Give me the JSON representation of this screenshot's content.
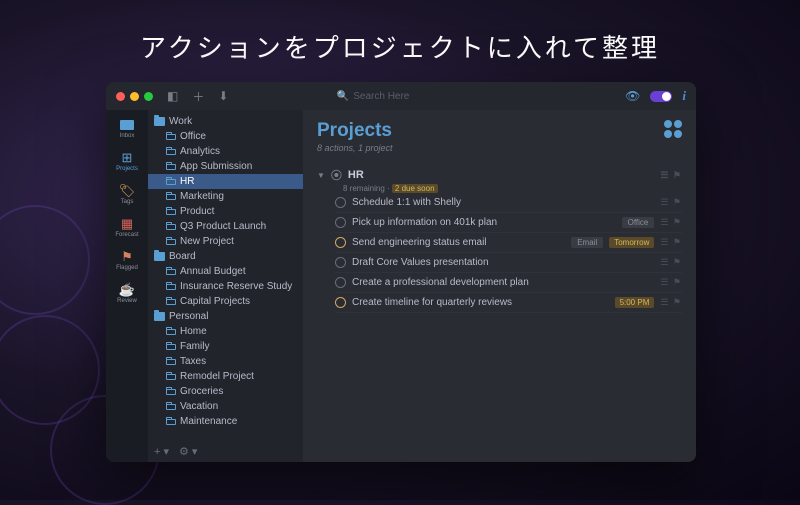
{
  "tagline": "アクションをプロジェクトに入れて整理",
  "toolbar": {
    "search_placeholder": "Search Here"
  },
  "rail": {
    "inbox": "Inbox",
    "projects": "Projects",
    "tags": "Tags",
    "forecast": "Forecast",
    "flagged": "Flagged",
    "review": "Review"
  },
  "outline": {
    "folders": [
      {
        "name": "Work",
        "projects": [
          "Office",
          "Analytics",
          "App Submission",
          "HR",
          "Marketing",
          "Product",
          "Q3 Product Launch",
          "New Project"
        ]
      },
      {
        "name": "Board",
        "projects": [
          "Annual Budget",
          "Insurance Reserve Study",
          "Capital Projects"
        ]
      },
      {
        "name": "Personal",
        "projects": [
          "Home",
          "Family",
          "Taxes",
          "Remodel Project",
          "Groceries",
          "Vacation",
          "Maintenance"
        ]
      }
    ],
    "selected": "HR"
  },
  "main": {
    "title": "Projects",
    "subtitle": "8 actions, 1 project",
    "group": {
      "name": "HR",
      "remaining": "8 remaining",
      "due_soon": "2 due soon"
    },
    "tasks": [
      {
        "title": "Schedule 1:1 with Shelly",
        "tag": "",
        "due": "",
        "soon": false
      },
      {
        "title": "Pick up information on 401k plan",
        "tag": "Office",
        "due": "",
        "soon": false
      },
      {
        "title": "Send engineering status email",
        "tag": "Email",
        "due": "Tomorrow",
        "soon": true
      },
      {
        "title": "Draft Core Values presentation",
        "tag": "",
        "due": "",
        "soon": false
      },
      {
        "title": "Create a professional development plan",
        "tag": "",
        "due": "",
        "soon": false
      },
      {
        "title": "Create timeline for quarterly reviews",
        "tag": "",
        "due": "5:00 PM",
        "soon": true
      }
    ]
  }
}
